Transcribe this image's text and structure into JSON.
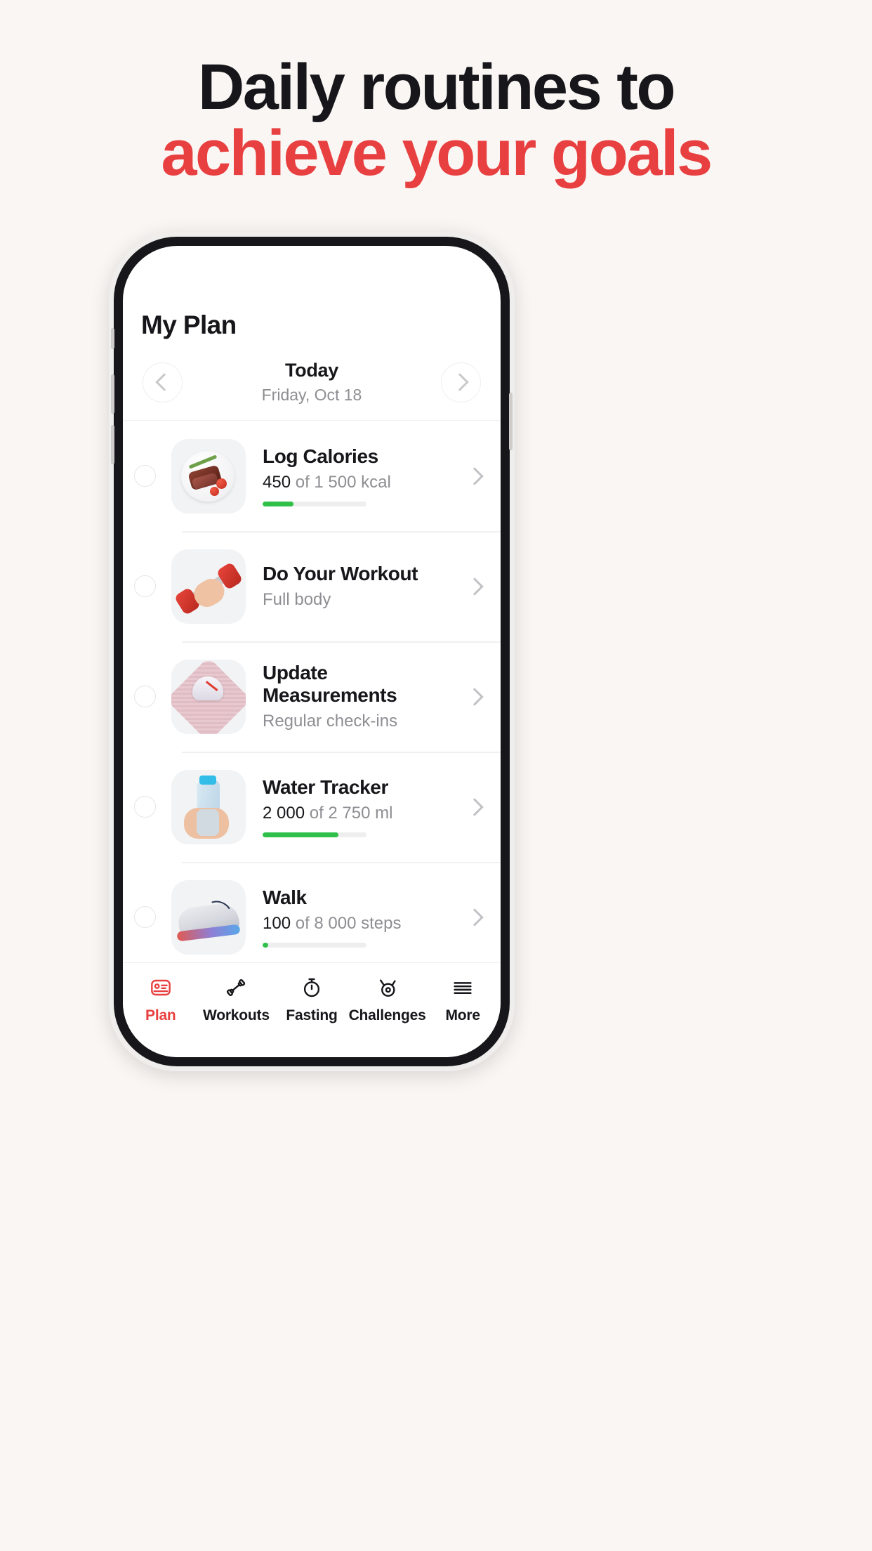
{
  "headline": {
    "line1": "Daily routines to",
    "line2": "achieve your goals",
    "accent_color": "#e84040",
    "dark_color": "#17161a",
    "background_color": "#faf6f4"
  },
  "app": {
    "title": "My Plan",
    "date_nav": {
      "prev_icon": "chevron-left-icon",
      "next_icon": "chevron-right-icon",
      "label": "Today",
      "sub": "Friday, Oct 18"
    },
    "tasks": [
      {
        "checkbox": "unchecked",
        "thumb": "steak-plate-image",
        "title": "Log Calories",
        "value": "450",
        "rest": " of 1 500 kcal",
        "progress_pct": 30,
        "progress_color": "#2fc04a",
        "chevron": "chevron-right-icon"
      },
      {
        "checkbox": "unchecked",
        "thumb": "dumbbell-hand-image",
        "title": "Do Your Workout",
        "value": "",
        "rest": "Full body",
        "progress_pct": null,
        "progress_color": "#2fc04a",
        "chevron": "chevron-right-icon"
      },
      {
        "checkbox": "unchecked",
        "thumb": "bathroom-scale-image",
        "title": "Update Measurements",
        "value": "",
        "rest": "Regular check-ins",
        "progress_pct": null,
        "progress_color": "#2fc04a",
        "chevron": "chevron-right-icon"
      },
      {
        "checkbox": "unchecked",
        "thumb": "water-bottle-image",
        "title": "Water Tracker",
        "value": "2 000",
        "rest": " of 2 750 ml",
        "progress_pct": 73,
        "progress_color": "#2fc04a",
        "chevron": "chevron-right-icon"
      },
      {
        "checkbox": "unchecked",
        "thumb": "running-shoe-image",
        "title": "Walk",
        "value": "100",
        "rest": " of 8 000 steps",
        "progress_pct": 3,
        "progress_color": "#2fc04a",
        "chevron": "chevron-right-icon"
      }
    ],
    "tabs": [
      {
        "label": "Plan",
        "icon": "plan-card-icon",
        "active": true
      },
      {
        "label": "Workouts",
        "icon": "dumbbell-icon",
        "active": false
      },
      {
        "label": "Fasting",
        "icon": "stopwatch-icon",
        "active": false
      },
      {
        "label": "Challenges",
        "icon": "medal-icon",
        "active": false
      },
      {
        "label": "More",
        "icon": "hamburger-icon",
        "active": false
      }
    ]
  }
}
